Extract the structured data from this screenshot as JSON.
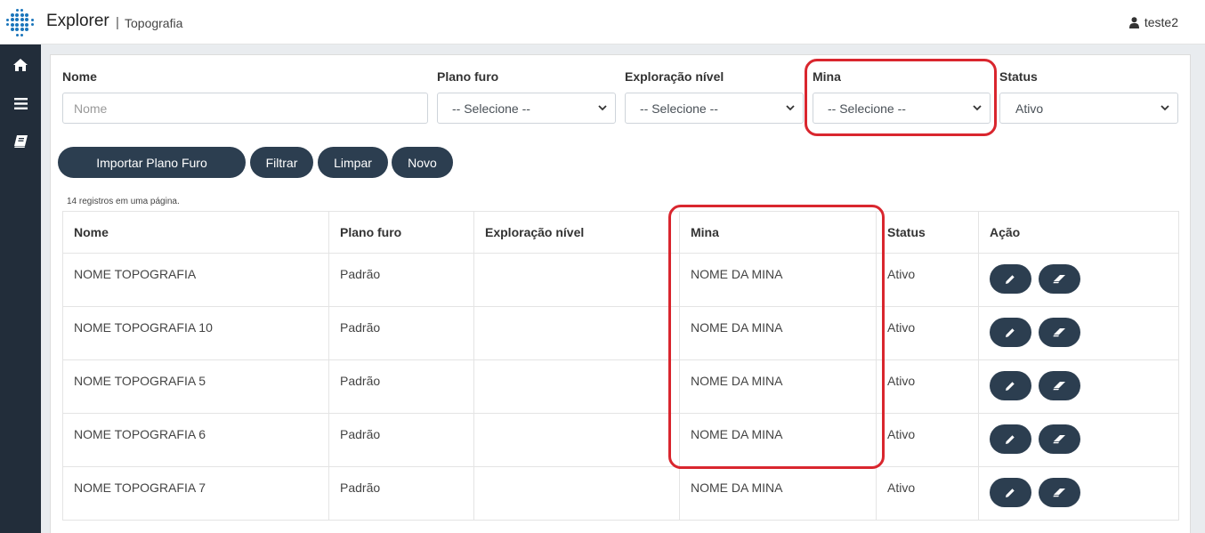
{
  "header": {
    "app_title": "Explorer",
    "separator": "|",
    "breadcrumb": "Topografia",
    "user_name": "teste2"
  },
  "sidebar": {
    "items": [
      {
        "icon": "home-icon"
      },
      {
        "icon": "menu-icon"
      },
      {
        "icon": "book-icon"
      }
    ]
  },
  "filters": {
    "nome": {
      "label": "Nome",
      "placeholder": "Nome"
    },
    "plano_furo": {
      "label": "Plano furo",
      "value": "-- Selecione --"
    },
    "exploracao_nivel": {
      "label": "Exploração nível",
      "value": "-- Selecione --"
    },
    "mina": {
      "label": "Mina",
      "value": "-- Selecione --"
    },
    "status": {
      "label": "Status",
      "value": "Ativo"
    }
  },
  "actions": {
    "import_label": "Importar Plano Furo",
    "filter_label": "Filtrar",
    "clear_label": "Limpar",
    "new_label": "Novo"
  },
  "table": {
    "record_count": "14 registros em uma página.",
    "columns": [
      "Nome",
      "Plano furo",
      "Exploração nível",
      "Mina",
      "Status",
      "Ação"
    ],
    "rows": [
      {
        "nome": "NOME TOPOGRAFIA",
        "plano_furo": "Padrão",
        "exploracao_nivel": "",
        "mina": "NOME DA MINA",
        "status": "Ativo"
      },
      {
        "nome": "NOME TOPOGRAFIA 10",
        "plano_furo": "Padrão",
        "exploracao_nivel": "",
        "mina": "NOME DA MINA",
        "status": "Ativo"
      },
      {
        "nome": "NOME TOPOGRAFIA 5",
        "plano_furo": "Padrão",
        "exploracao_nivel": "",
        "mina": "NOME DA MINA",
        "status": "Ativo"
      },
      {
        "nome": "NOME TOPOGRAFIA 6",
        "plano_furo": "Padrão",
        "exploracao_nivel": "",
        "mina": "NOME DA MINA",
        "status": "Ativo"
      },
      {
        "nome": "NOME TOPOGRAFIA 7",
        "plano_furo": "Padrão",
        "exploracao_nivel": "",
        "mina": "NOME DA MINA",
        "status": "Ativo"
      }
    ]
  },
  "colors": {
    "sidebar_bg": "#222d3a",
    "button_bg": "#2c3e50",
    "highlight": "#d9262e",
    "logo": "#1a75bb"
  }
}
